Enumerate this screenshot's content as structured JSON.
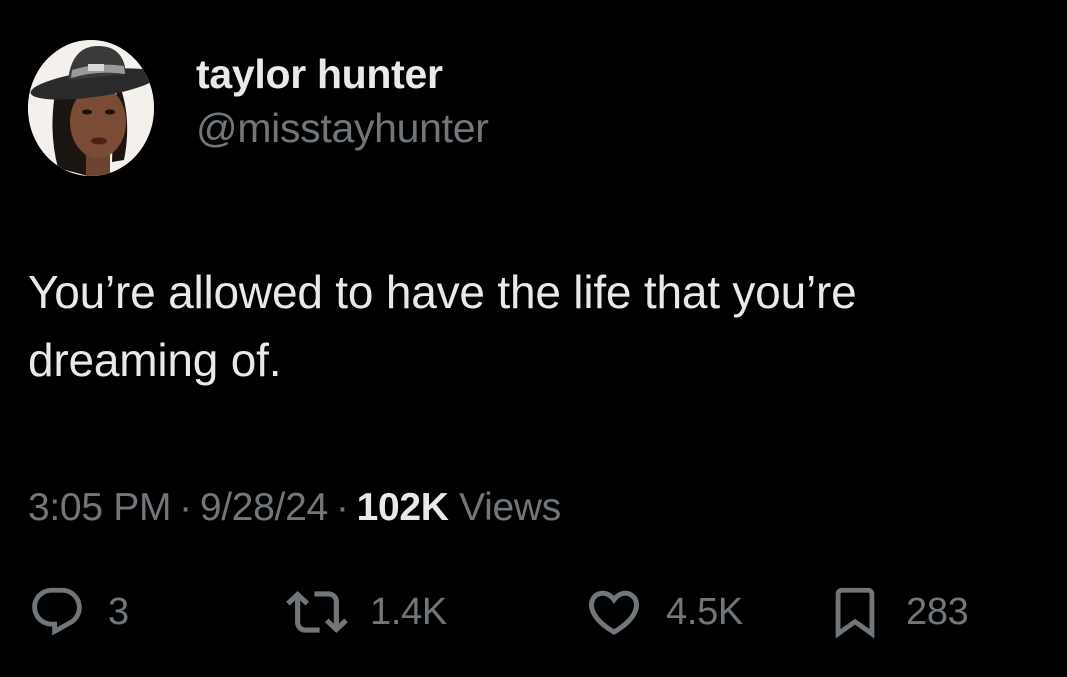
{
  "user": {
    "display_name": "taylor hunter",
    "handle": "@misstayhunter",
    "avatar_icon": "profile-photo"
  },
  "tweet": {
    "text": "You’re allowed to have the life that you’re dreaming of."
  },
  "meta": {
    "time": "3:05 PM",
    "date": "9/28/24",
    "separator": "·",
    "views_count": "102K",
    "views_label": "Views"
  },
  "actions": {
    "reply": {
      "icon": "reply-icon",
      "count": "3"
    },
    "retweet": {
      "icon": "retweet-icon",
      "count": "1.4K"
    },
    "like": {
      "icon": "heart-icon",
      "count": "4.5K"
    },
    "bookmark": {
      "icon": "bookmark-icon",
      "count": "283"
    }
  },
  "colors": {
    "background": "#000000",
    "primary_text": "#e7e9ea",
    "secondary_text": "#71767b"
  }
}
